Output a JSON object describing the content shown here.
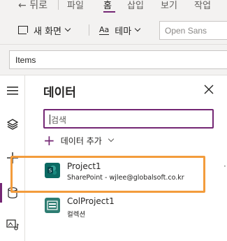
{
  "menubar": {
    "back_label": "뒤로",
    "items": [
      "파일",
      "홈",
      "삽입",
      "보기",
      "작업"
    ],
    "active": "홈"
  },
  "toolbar": {
    "new_screen_label": "새 화면",
    "theme_label": "테마",
    "theme_icon_text": "Aa",
    "font_value": "Open Sans"
  },
  "formula": {
    "property": "Items"
  },
  "rail": {
    "icons": [
      "hamburger-icon",
      "layers-icon",
      "plus-icon",
      "database-icon",
      "media-icon"
    ],
    "selected": "database-icon"
  },
  "pane": {
    "title": "데이터",
    "search_placeholder": "검색",
    "add_data_label": "데이터 추가",
    "sources": [
      {
        "name": "Project1",
        "subtitle": "SharePoint - wjlee@globalsoft.co.kr",
        "icon": "sharepoint-icon"
      },
      {
        "name": "ColProject1",
        "subtitle": "컬렉션",
        "icon": "collection-icon"
      }
    ],
    "highlight_color": "#f39c3c"
  },
  "colors": {
    "accent": "#742774",
    "chrome_bg": "#f3f2f1"
  }
}
